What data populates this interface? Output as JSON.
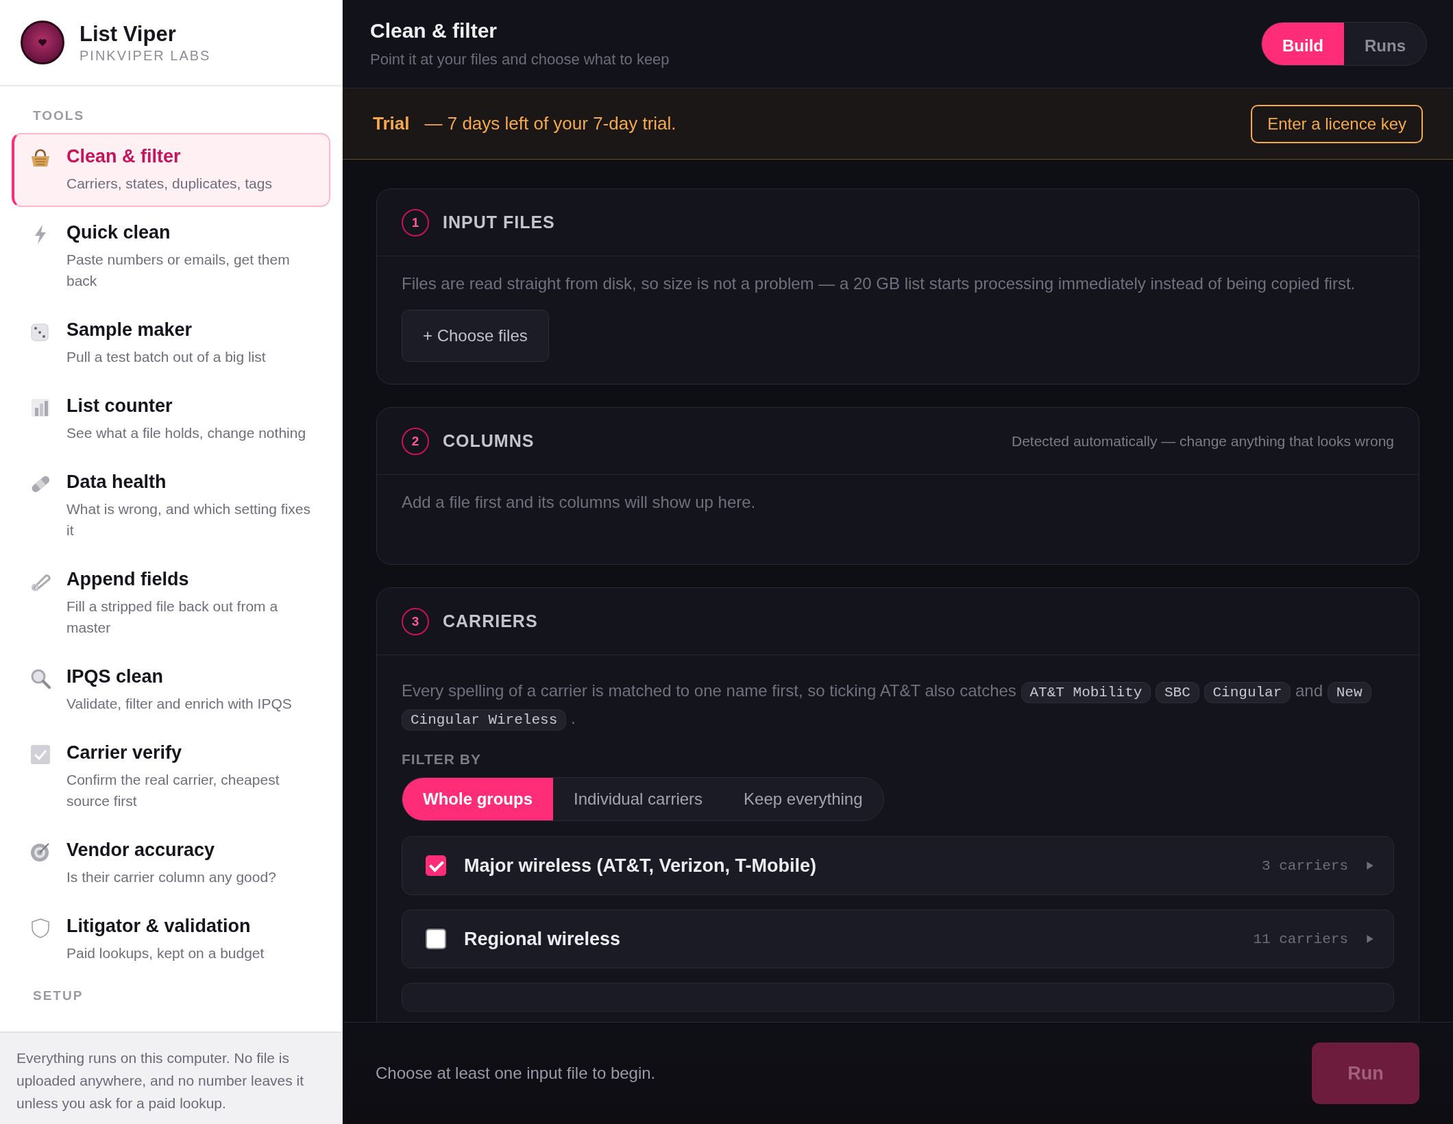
{
  "app": {
    "name": "List Viper",
    "company": "PINKVIPER LABS"
  },
  "sidebar": {
    "section_label": "TOOLS",
    "items": [
      {
        "title": "Clean & filter",
        "subtitle": "Carriers, states, duplicates, tags",
        "selected": true
      },
      {
        "title": "Quick clean",
        "subtitle": "Paste numbers or emails, get them back",
        "selected": false
      },
      {
        "title": "Sample maker",
        "subtitle": "Pull a test batch out of a big list",
        "selected": false
      },
      {
        "title": "List counter",
        "subtitle": "See what a file holds, change nothing",
        "selected": false
      },
      {
        "title": "Data health",
        "subtitle": "What is wrong, and which setting fixes it",
        "selected": false
      },
      {
        "title": "Append fields",
        "subtitle": "Fill a stripped file back out from a master",
        "selected": false
      },
      {
        "title": "IPQS clean",
        "subtitle": "Validate, filter and enrich with IPQS",
        "selected": false
      },
      {
        "title": "Carrier verify",
        "subtitle": "Confirm the real carrier, cheapest source first",
        "selected": false
      },
      {
        "title": "Vendor accuracy",
        "subtitle": "Is their carrier column any good?",
        "selected": false
      },
      {
        "title": "Litigator & validation",
        "subtitle": "Paid lookups, kept on a budget",
        "selected": false
      }
    ],
    "next_section_label": "SETUP",
    "footer_note": "Everything runs on this computer. No file is uploaded anywhere, and no number leaves it unless you ask for a paid lookup."
  },
  "header": {
    "title": "Clean & filter",
    "subtitle": "Point it at your files and choose what to keep",
    "modes": [
      {
        "label": "Build",
        "selected": true
      },
      {
        "label": "Runs",
        "selected": false
      }
    ]
  },
  "trial_banner": {
    "label": "Trial",
    "message": "— 7 days left of your 7-day trial.",
    "button": "Enter a licence key"
  },
  "sections": [
    {
      "number": "1",
      "title": "INPUT FILES",
      "body": "Files are read straight from disk, so size is not a problem — a 20 GB list starts processing immediately instead of being copied first.",
      "button": "+ Choose files"
    },
    {
      "number": "2",
      "title": "COLUMNS",
      "hint": "Detected automatically — change anything that looks wrong",
      "body": "Add a file first and its columns will show up here."
    },
    {
      "number": "3",
      "title": "CARRIERS",
      "note": [
        {
          "kind": "text",
          "text": "Every spelling of a carrier is matched to one name first, so ticking AT&T also catches"
        },
        {
          "kind": "code",
          "text": "AT&T Mobility"
        },
        {
          "kind": "code",
          "text": "SBC"
        },
        {
          "kind": "code",
          "text": "Cingular"
        },
        {
          "kind": "text",
          "text": "and"
        },
        {
          "kind": "code",
          "text": "New Cingular Wireless"
        },
        {
          "kind": "text",
          "text": "."
        }
      ],
      "filter_label": "FILTER BY",
      "filter_options": [
        {
          "label": "Whole groups",
          "selected": true
        },
        {
          "label": "Individual carriers",
          "selected": false
        },
        {
          "label": "Keep everything",
          "selected": false
        }
      ],
      "groups": [
        {
          "name": "Major wireless (AT&T, Verizon, T-Mobile)",
          "count": "3 carriers",
          "checked": true
        },
        {
          "name": "Regional wireless",
          "count": "11 carriers",
          "checked": false
        }
      ]
    }
  ],
  "footer": {
    "message": "Choose at least one input file to begin.",
    "button": "Run",
    "disabled": true
  }
}
